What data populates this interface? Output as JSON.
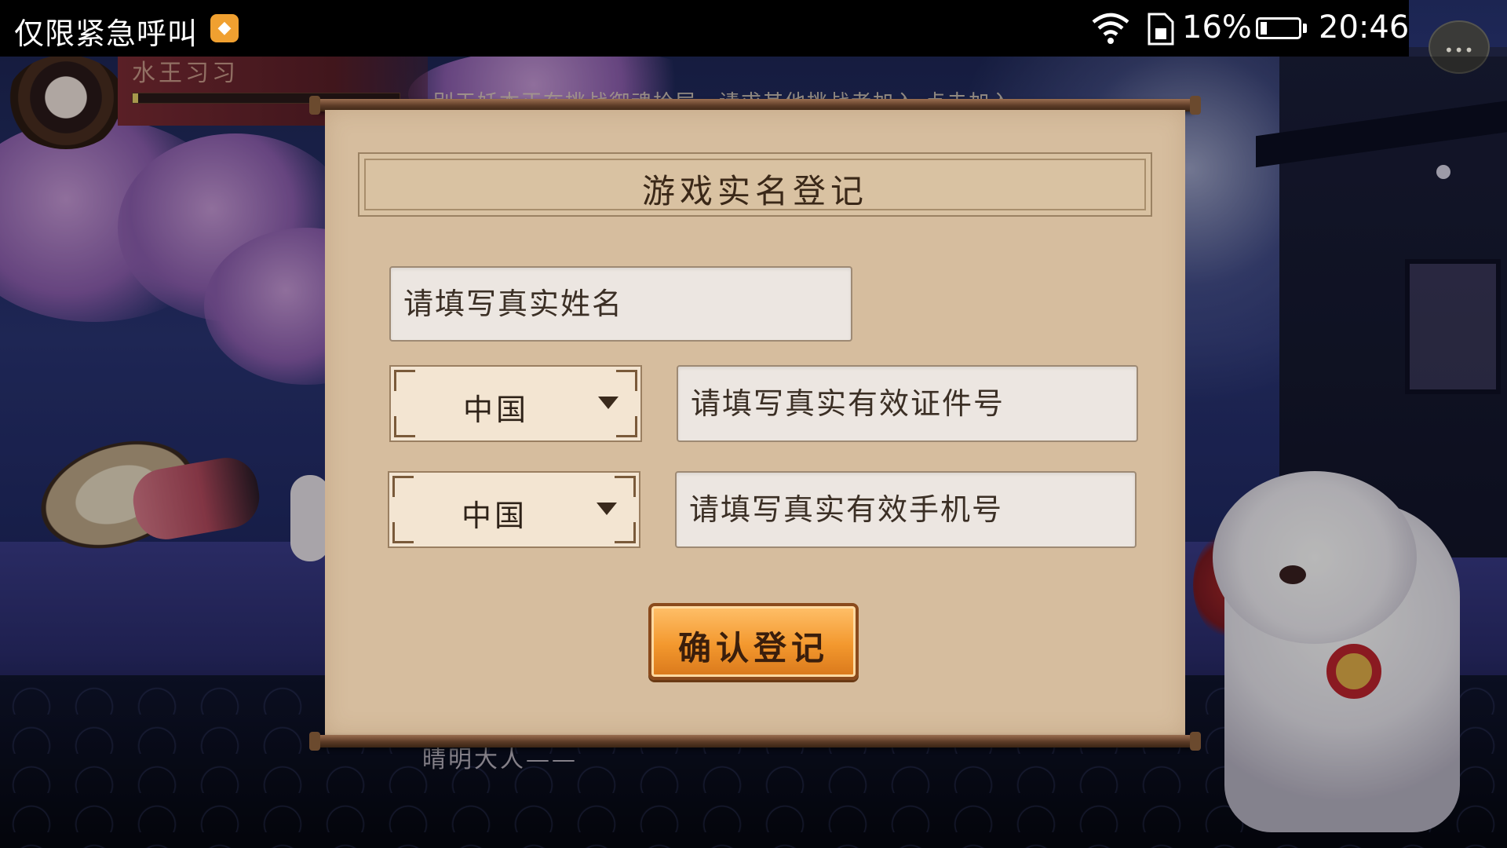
{
  "status_bar": {
    "carrier_text": "仅限紧急呼叫",
    "app_icon": "weibo-notification-icon",
    "wifi_icon": "wifi-icon",
    "sim_icon": "sim-card-icon",
    "battery_percent": "16%",
    "battery_level": 0.16,
    "time": "20:46"
  },
  "game_hud": {
    "player_name": "水王习习",
    "hp_fraction": 0.02,
    "marquee_text": "别天妖本正在挑战御魂拾层，请求其他挑战者加入  点击加入",
    "subtitle_text": "晴明大人——",
    "chat_icon": "chat-bubble-icon"
  },
  "dialog": {
    "title": "游戏实名登记",
    "name_placeholder": "请填写真实姓名",
    "id_country": "中国",
    "id_placeholder": "请填写真实有效证件号",
    "phone_country": "中国",
    "phone_placeholder": "请填写真实有效手机号",
    "confirm_label": "确认登记"
  },
  "colors": {
    "paper": "#d6bd9e",
    "confirm_button": "#f3982e",
    "status_bar": "#000000"
  }
}
